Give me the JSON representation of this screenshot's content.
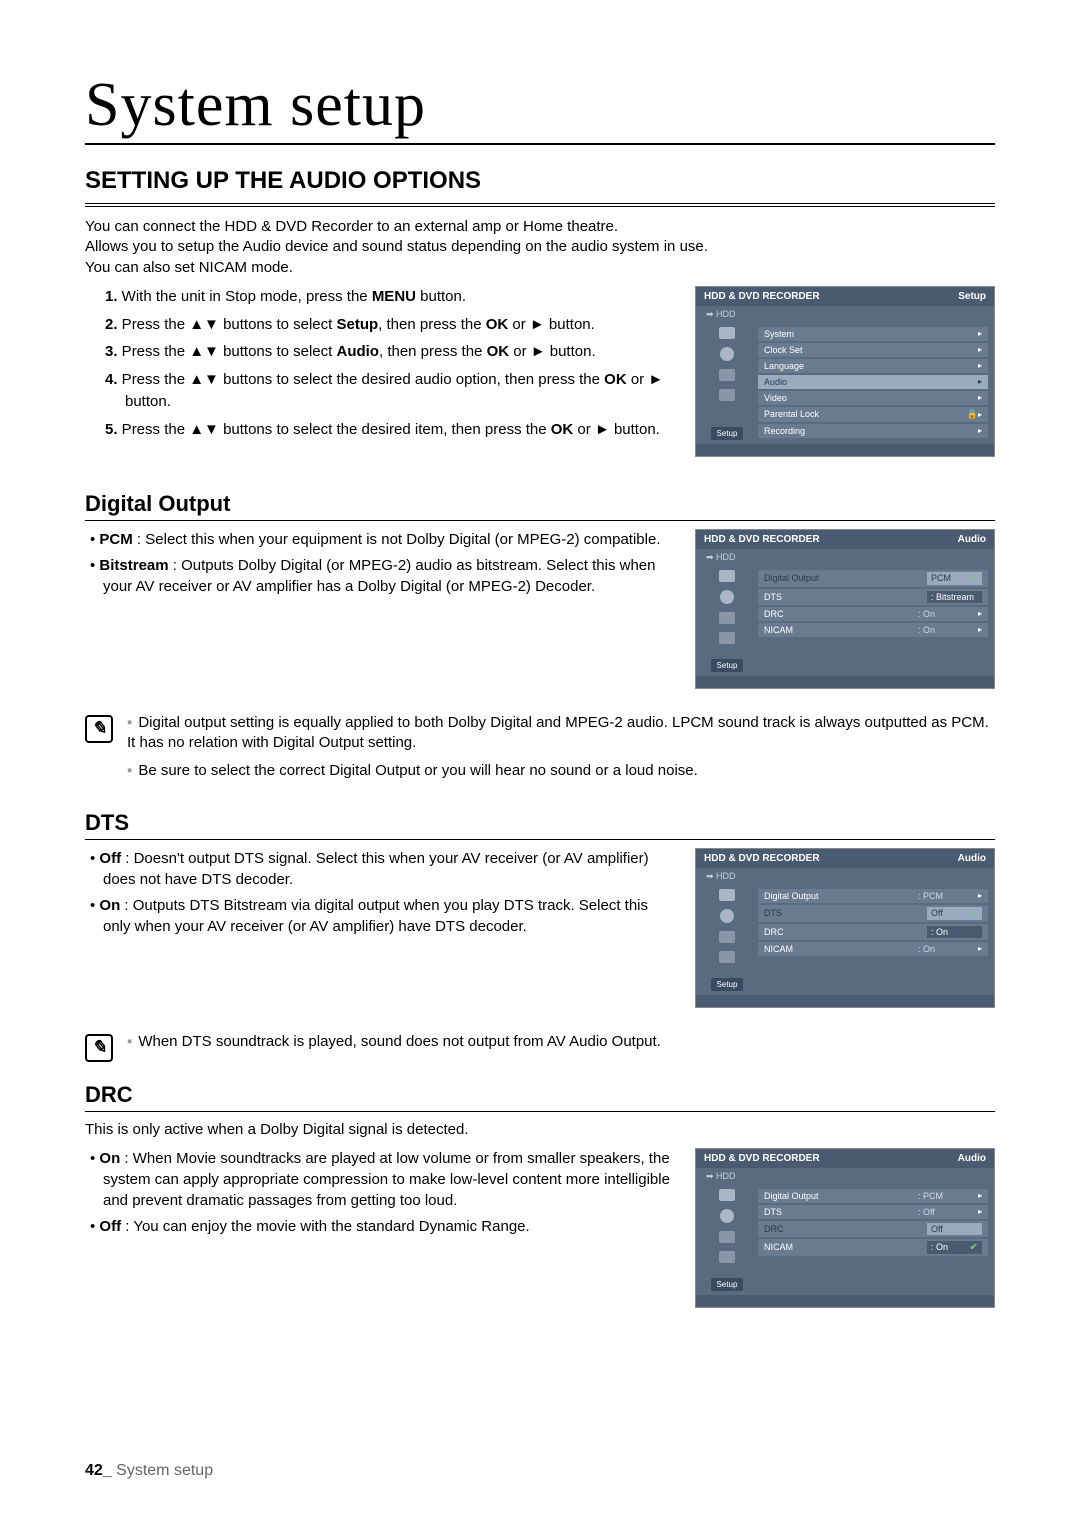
{
  "page_title": "System setup",
  "section_title": "SETTING UP THE AUDIO OPTIONS",
  "intro": [
    "You can connect the HDD & DVD Recorder to an external amp or Home theatre.",
    "Allows you to setup the Audio device and sound status depending on the audio system in use.",
    "You can also set NICAM mode."
  ],
  "steps": [
    {
      "n": "1.",
      "pre": "With the unit in Stop mode, press the ",
      "b": "MENU",
      "post": " button."
    },
    {
      "n": "2.",
      "pre": "Press the ▲▼ buttons to select ",
      "b": "Setup",
      "mid": ", then press the ",
      "b2": "OK",
      "post": " or ► button."
    },
    {
      "n": "3.",
      "pre": "Press the ▲▼ buttons to select ",
      "b": "Audio",
      "mid": ", then press the ",
      "b2": "OK",
      "post": " or ► button."
    },
    {
      "n": "4.",
      "pre": "Press the ▲▼ buttons to select the desired audio option, then press the ",
      "b": "OK",
      "post": " or ► button."
    },
    {
      "n": "5.",
      "pre": "Press the ▲▼ buttons to select the desired item, then press the ",
      "b": "OK",
      "post": " or ► button."
    }
  ],
  "digital_output": {
    "title": "Digital Output",
    "bullets": [
      {
        "b": "PCM",
        "t": " : Select this when your equipment is not Dolby Digital (or MPEG-2) compatible."
      },
      {
        "b": "Bitstream",
        "t": " : Outputs Dolby Digital (or MPEG-2) audio as bitstream. Select this when your AV receiver or AV amplifier has a Dolby Digital (or MPEG-2) Decoder."
      }
    ],
    "notes": [
      "Digital output setting is equally applied to both Dolby Digital and MPEG-2 audio. LPCM sound track is always outputted as PCM. It has no relation with Digital Output setting.",
      "Be sure to select the correct Digital Output or you will hear no sound or a loud noise."
    ]
  },
  "dts": {
    "title": "DTS",
    "bullets": [
      {
        "b": "Off",
        "t": " : Doesn't output DTS signal. Select this when your AV receiver (or AV amplifier) does not have DTS decoder."
      },
      {
        "b": "On",
        "t": " : Outputs DTS Bitstream via digital output when you play DTS track. Select this only when your AV receiver (or AV amplifier) have DTS decoder."
      }
    ],
    "notes": [
      "When DTS soundtrack is played, sound does not output from AV Audio Output."
    ]
  },
  "drc": {
    "title": "DRC",
    "intro": "This is only active when a Dolby Digital signal is detected.",
    "bullets": [
      {
        "b": "On",
        "t": " : When Movie soundtracks are played at low volume or from smaller speakers, the system can apply appropriate compression to make low-level content more intelligible and prevent dramatic passages from getting too loud."
      },
      {
        "b": "Off",
        "t": " : You can enjoy the movie with the standard Dynamic Range."
      }
    ]
  },
  "osd": {
    "header_title": "HDD & DVD RECORDER",
    "header_setup": "Setup",
    "header_audio": "Audio",
    "sub": "➡ HDD",
    "setup_btn": "Setup",
    "main_menu": [
      {
        "label": "System"
      },
      {
        "label": "Clock Set"
      },
      {
        "label": "Language"
      },
      {
        "label": "Audio",
        "selected": true
      },
      {
        "label": "Video"
      },
      {
        "label": "Parental Lock",
        "lock": true
      },
      {
        "label": "Recording"
      }
    ],
    "audio_menu_do": [
      {
        "label": "Digital Output",
        "val": "PCM",
        "sel": true,
        "opt": "PCM",
        "chk": true
      },
      {
        "label": "DTS",
        "val": "",
        "opt": "Bitstream"
      },
      {
        "label": "DRC",
        "val": "On",
        "arr": true
      },
      {
        "label": "NICAM",
        "val": "On",
        "arr": true
      }
    ],
    "audio_menu_dts": [
      {
        "label": "Digital Output",
        "val": "PCM",
        "arr": true
      },
      {
        "label": "DTS",
        "val": "Off",
        "sel": true,
        "opt": "Off",
        "chk": true
      },
      {
        "label": "DRC",
        "val": "",
        "opt": "On"
      },
      {
        "label": "NICAM",
        "val": "On",
        "arr": true
      }
    ],
    "audio_menu_drc": [
      {
        "label": "Digital Output",
        "val": "PCM",
        "arr": true
      },
      {
        "label": "DTS",
        "val": "Off",
        "arr": true
      },
      {
        "label": "DRC",
        "val": "Off",
        "sel": true,
        "opt": "Off"
      },
      {
        "label": "NICAM",
        "val": "On",
        "opt": "On",
        "chk": true
      }
    ]
  },
  "footer": {
    "page": "42_",
    "section": "System setup"
  }
}
